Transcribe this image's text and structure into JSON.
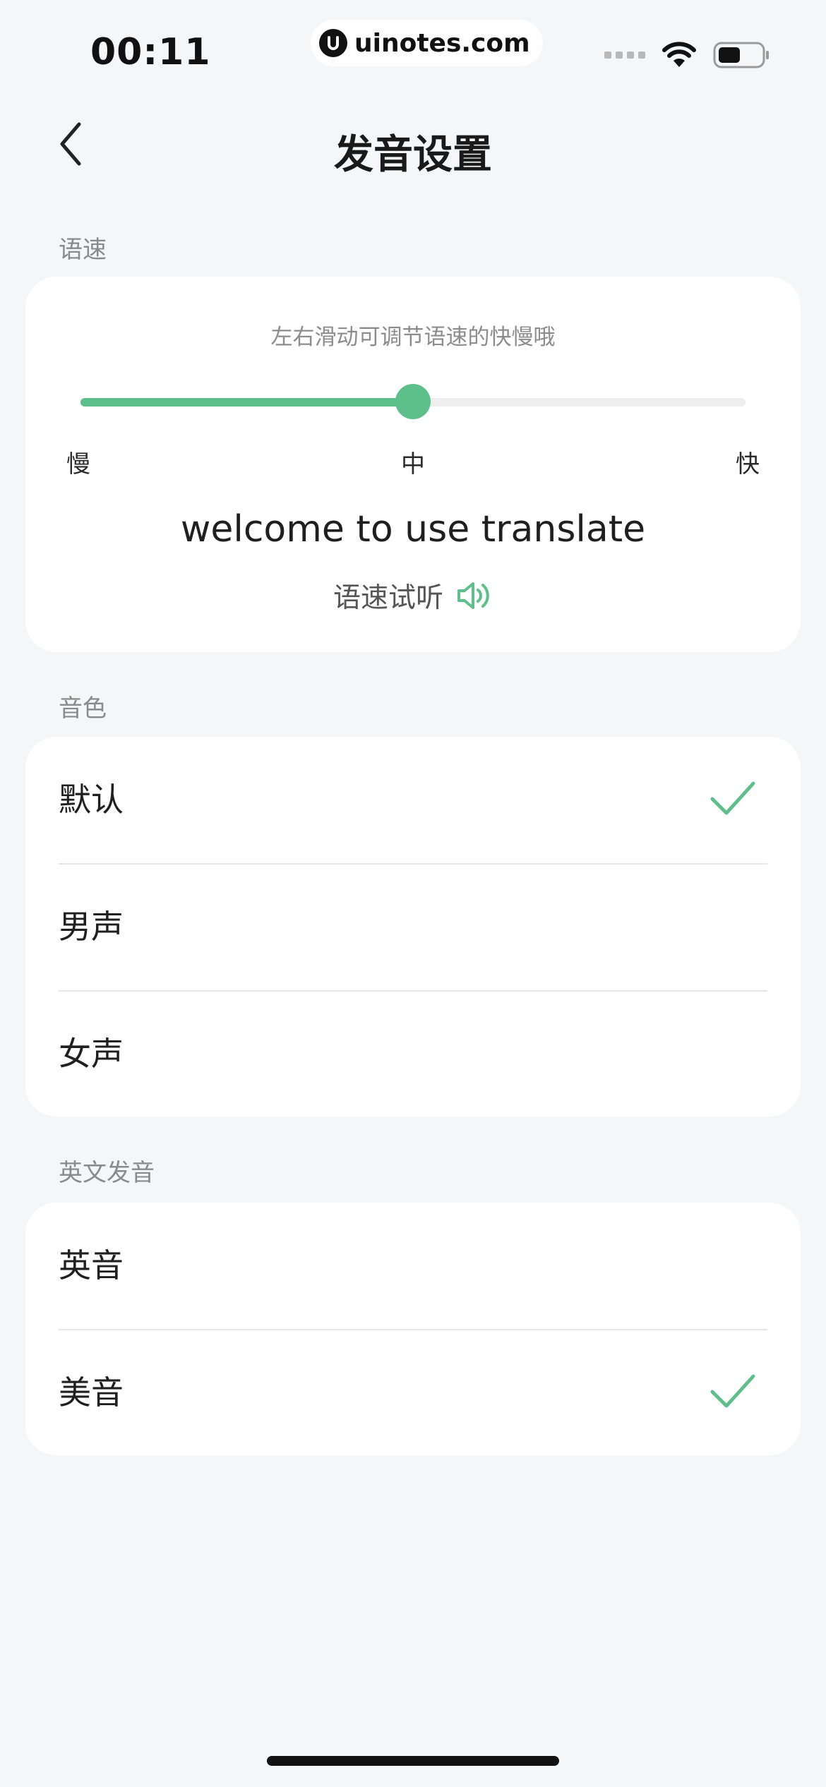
{
  "status_bar": {
    "time": "00:11",
    "watermark": "uinotes.com"
  },
  "nav": {
    "title": "发音设置"
  },
  "speed_section": {
    "label": "语速",
    "hint": "左右滑动可调节语速的快慢哦",
    "slider_value": 0.5,
    "scale": {
      "slow": "慢",
      "medium": "中",
      "fast": "快"
    },
    "sample_text": "welcome to use translate",
    "preview_label": "语速试听"
  },
  "voice_section": {
    "label": "音色",
    "items": [
      {
        "label": "默认",
        "selected": true
      },
      {
        "label": "男声",
        "selected": false
      },
      {
        "label": "女声",
        "selected": false
      }
    ]
  },
  "english_section": {
    "label": "英文发音",
    "items": [
      {
        "label": "英音",
        "selected": false
      },
      {
        "label": "美音",
        "selected": true
      }
    ]
  },
  "icons": {
    "back": "chevron-left-icon",
    "speaker": "speaker-icon",
    "check": "check-icon",
    "wifi": "wifi-icon",
    "battery": "battery-icon"
  },
  "colors": {
    "accent": "#5dc08a",
    "background": "#f5f6f8",
    "card": "#ffffff"
  }
}
